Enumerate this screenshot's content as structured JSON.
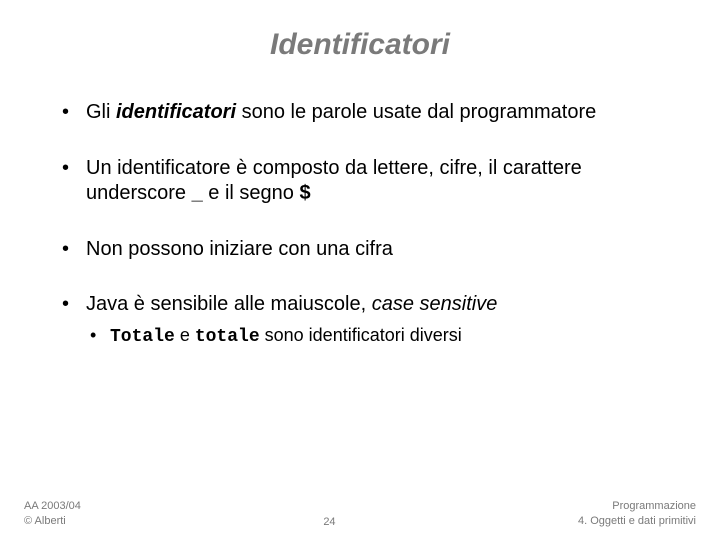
{
  "title": "Identificatori",
  "bullets": {
    "b1": {
      "pre": "Gli ",
      "strong": "identificatori",
      "post": " sono le parole usate dal programmatore"
    },
    "b2": {
      "pre": "Un identificatore è composto da lettere, cifre, il carattere underscore ",
      "us": "_",
      "mid": " e il segno ",
      "dollar": "$"
    },
    "b3": "Non possono iniziare con una cifra",
    "b4": {
      "pre": "Java è sensibile alle maiuscole, ",
      "em": "case sensitive"
    },
    "sub1": {
      "t1": "Totale",
      "mid1": " e ",
      "t2": "totale",
      "post": " sono identificatori diversi"
    }
  },
  "footer": {
    "left1": "AA 2003/04",
    "left2": "© Alberti",
    "center": "24",
    "right1": "Programmazione",
    "right2": "4. Oggetti e dati primitivi"
  }
}
